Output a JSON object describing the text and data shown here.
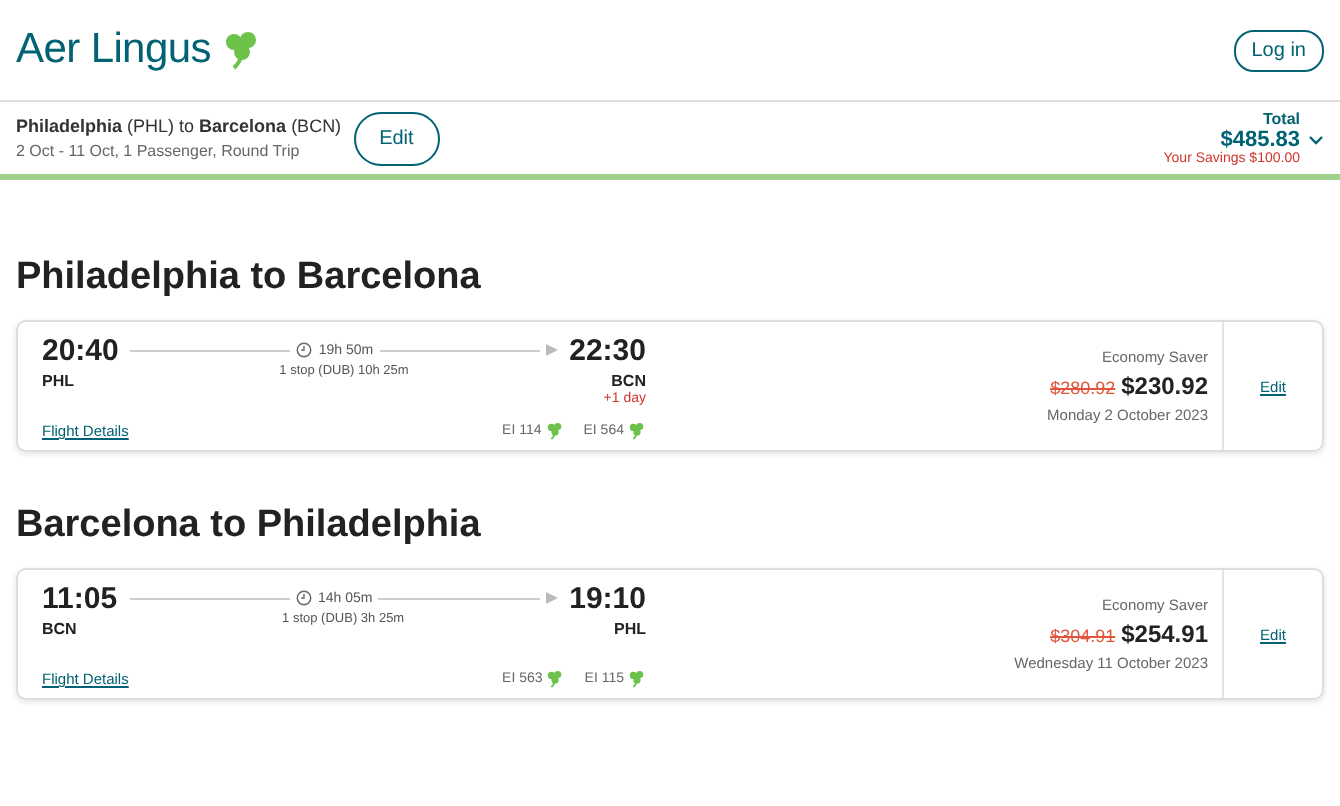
{
  "header": {
    "logo": "Aer Lingus",
    "login_button": "Log in"
  },
  "summary": {
    "route": "**Philadelphia** (PHL) to **Barcelona** (BCN)",
    "details": "2 Oct - 11 Oct, 1 Passenger, Round Trip",
    "edit_button": "Edit",
    "total_label": "Total",
    "total": "$485.83",
    "savings": "Your Savings $100.00"
  },
  "journeys": [
    {
      "title": "Philadelphia to Barcelona",
      "depart_time": "20:40",
      "depart_code": "PHL",
      "duration": "19h 50m",
      "stops": "1 stop (DUB) 10h 25m",
      "arrive_time": "22:30",
      "arrive_code": "BCN",
      "day_offset": "+1 day",
      "details_link": "Flight Details",
      "flights": [
        "EI 114",
        "EI 564"
      ],
      "fare": "Economy Saver",
      "old_price": "$280.92",
      "price": "$230.92",
      "date": "Monday 2 October 2023",
      "edit_link": "Edit"
    },
    {
      "title": "Barcelona to Philadelphia",
      "depart_time": "11:05",
      "depart_code": "BCN",
      "duration": "14h 05m",
      "stops": "1 stop (DUB) 3h 25m",
      "arrive_time": "19:10",
      "arrive_code": "PHL",
      "details_link": "Flight Details",
      "flights": [
        "EI 563",
        "EI 115"
      ],
      "fare": "Economy Saver",
      "old_price": "$304.91",
      "price": "$254.91",
      "date": "Wednesday 11 October 2023",
      "edit_link": "Edit"
    }
  ]
}
